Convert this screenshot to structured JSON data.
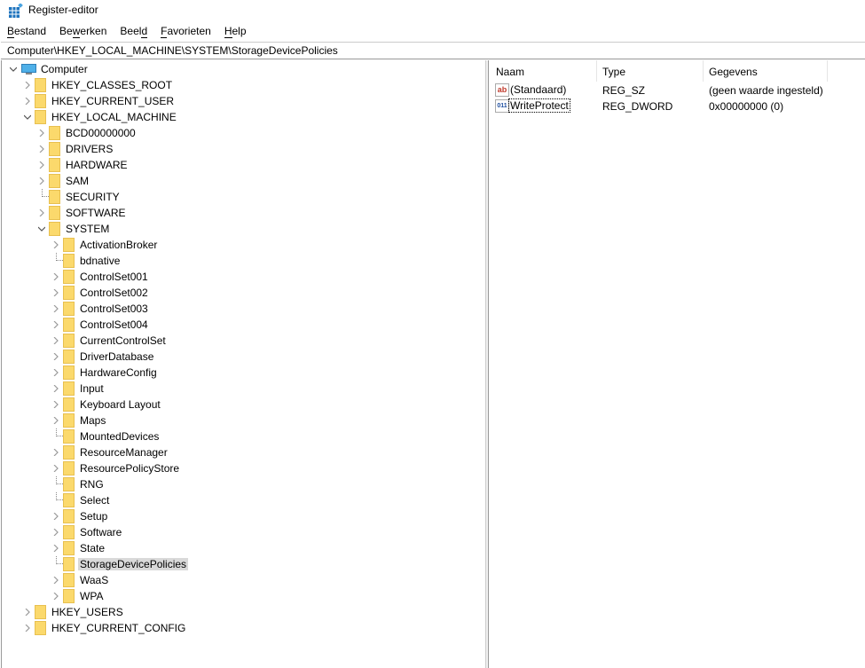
{
  "window": {
    "title": "Register-editor"
  },
  "menu": [
    {
      "label": "Bestand",
      "u": "B"
    },
    {
      "label": "Bewerken",
      "u": "w"
    },
    {
      "label": "Beeld",
      "u": "d"
    },
    {
      "label": "Favorieten",
      "u": "F"
    },
    {
      "label": "Help",
      "u": "H"
    }
  ],
  "address": "Computer\\HKEY_LOCAL_MACHINE\\SYSTEM\\StorageDevicePolicies",
  "tree": [
    {
      "label": "Computer",
      "level": 0,
      "state": "expanded",
      "icon": "computer-icon"
    },
    {
      "label": "HKEY_CLASSES_ROOT",
      "level": 1,
      "state": "collapsed"
    },
    {
      "label": "HKEY_CURRENT_USER",
      "level": 1,
      "state": "collapsed"
    },
    {
      "label": "HKEY_LOCAL_MACHINE",
      "level": 1,
      "state": "expanded"
    },
    {
      "label": "BCD00000000",
      "level": 2,
      "state": "collapsed"
    },
    {
      "label": "DRIVERS",
      "level": 2,
      "state": "collapsed"
    },
    {
      "label": "HARDWARE",
      "level": 2,
      "state": "collapsed"
    },
    {
      "label": "SAM",
      "level": 2,
      "state": "collapsed"
    },
    {
      "label": "SECURITY",
      "level": 2,
      "state": "leaf"
    },
    {
      "label": "SOFTWARE",
      "level": 2,
      "state": "collapsed"
    },
    {
      "label": "SYSTEM",
      "level": 2,
      "state": "expanded"
    },
    {
      "label": "ActivationBroker",
      "level": 3,
      "state": "collapsed"
    },
    {
      "label": "bdnative",
      "level": 3,
      "state": "leaf"
    },
    {
      "label": "ControlSet001",
      "level": 3,
      "state": "collapsed"
    },
    {
      "label": "ControlSet002",
      "level": 3,
      "state": "collapsed"
    },
    {
      "label": "ControlSet003",
      "level": 3,
      "state": "collapsed"
    },
    {
      "label": "ControlSet004",
      "level": 3,
      "state": "collapsed"
    },
    {
      "label": "CurrentControlSet",
      "level": 3,
      "state": "collapsed"
    },
    {
      "label": "DriverDatabase",
      "level": 3,
      "state": "collapsed"
    },
    {
      "label": "HardwareConfig",
      "level": 3,
      "state": "collapsed"
    },
    {
      "label": "Input",
      "level": 3,
      "state": "collapsed"
    },
    {
      "label": "Keyboard Layout",
      "level": 3,
      "state": "collapsed"
    },
    {
      "label": "Maps",
      "level": 3,
      "state": "collapsed"
    },
    {
      "label": "MountedDevices",
      "level": 3,
      "state": "leaf"
    },
    {
      "label": "ResourceManager",
      "level": 3,
      "state": "collapsed"
    },
    {
      "label": "ResourcePolicyStore",
      "level": 3,
      "state": "collapsed"
    },
    {
      "label": "RNG",
      "level": 3,
      "state": "leaf"
    },
    {
      "label": "Select",
      "level": 3,
      "state": "leaf"
    },
    {
      "label": "Setup",
      "level": 3,
      "state": "collapsed"
    },
    {
      "label": "Software",
      "level": 3,
      "state": "collapsed"
    },
    {
      "label": "State",
      "level": 3,
      "state": "collapsed"
    },
    {
      "label": "StorageDevicePolicies",
      "level": 3,
      "state": "leaf",
      "selected": true
    },
    {
      "label": "WaaS",
      "level": 3,
      "state": "collapsed"
    },
    {
      "label": "WPA",
      "level": 3,
      "state": "collapsed"
    },
    {
      "label": "HKEY_USERS",
      "level": 1,
      "state": "collapsed"
    },
    {
      "label": "HKEY_CURRENT_CONFIG",
      "level": 1,
      "state": "collapsed"
    }
  ],
  "values": {
    "headers": {
      "name": "Naam",
      "type": "Type",
      "data": "Gegevens"
    },
    "rows": [
      {
        "name": "(Standaard)",
        "type": "REG_SZ",
        "data": "(geen waarde ingesteld)",
        "icon": "ab",
        "icon_color": "#c0392b"
      },
      {
        "name": "WriteProtect",
        "type": "REG_DWORD",
        "data": "0x00000000 (0)",
        "icon": "011",
        "icon_color": "#1f4fa0",
        "focused": true
      }
    ]
  }
}
